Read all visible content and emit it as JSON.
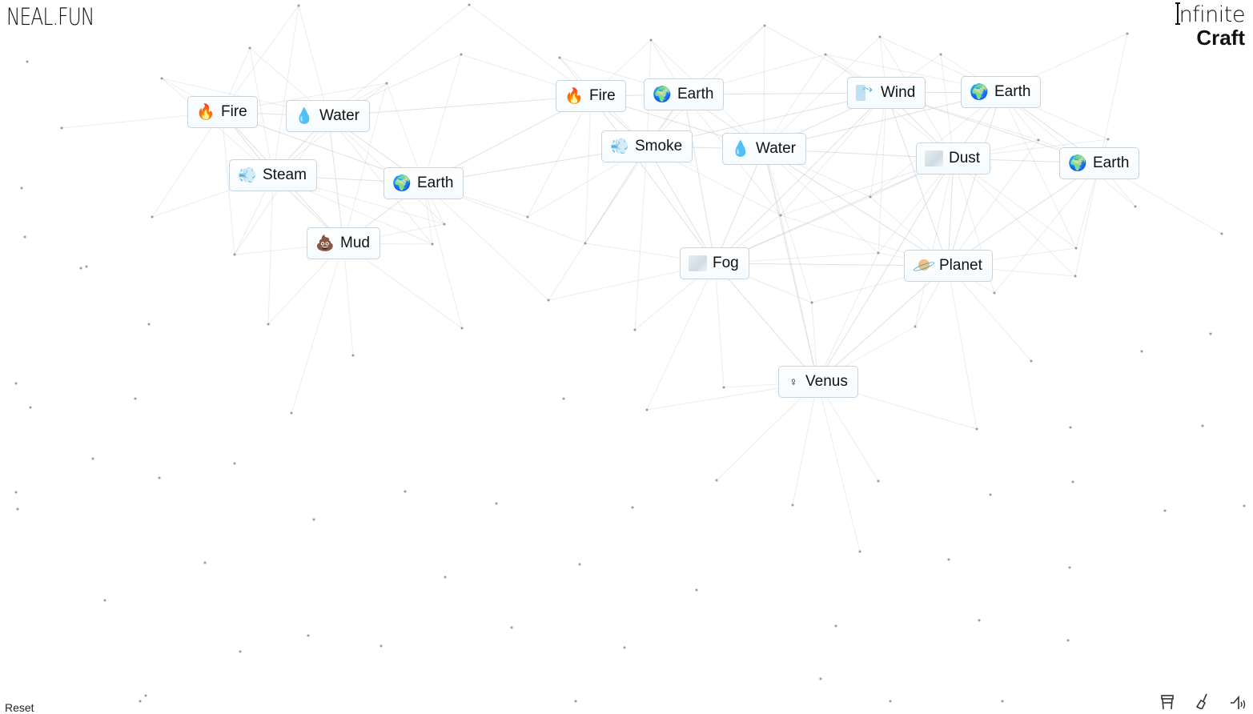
{
  "header": {
    "site_logo": "NEAL.FUN",
    "app_title_line1": "nfinite",
    "app_title_line2": "Craft"
  },
  "footer": {
    "reset_label": "Reset",
    "icons": [
      "coffee-cup-icon",
      "broom-clear-icon",
      "sound-icon"
    ]
  },
  "items": [
    {
      "id": "fire-1",
      "label": "Fire",
      "icon": "🔥",
      "icon_name": "fire-icon"
    },
    {
      "id": "water-1",
      "label": "Water",
      "icon": "💧",
      "icon_name": "water-drop-icon"
    },
    {
      "id": "steam",
      "label": "Steam",
      "icon": "💨",
      "icon_name": "steam-icon"
    },
    {
      "id": "earth-1",
      "label": "Earth",
      "icon": "🌍",
      "icon_name": "earth-globe-icon"
    },
    {
      "id": "mud",
      "label": "Mud",
      "icon": "💩",
      "icon_name": "mud-icon"
    },
    {
      "id": "fire-2",
      "label": "Fire",
      "icon": "🔥",
      "icon_name": "fire-icon"
    },
    {
      "id": "earth-2",
      "label": "Earth",
      "icon": "🌍",
      "icon_name": "earth-globe-icon"
    },
    {
      "id": "smoke",
      "label": "Smoke",
      "icon": "💨",
      "icon_name": "smoke-icon"
    },
    {
      "id": "water-2",
      "label": "Water",
      "icon": "💧",
      "icon_name": "water-drop-icon"
    },
    {
      "id": "wind",
      "label": "Wind",
      "icon": "",
      "icon_name": "wind-icon"
    },
    {
      "id": "earth-3",
      "label": "Earth",
      "icon": "🌍",
      "icon_name": "earth-globe-icon"
    },
    {
      "id": "dust",
      "label": "Dust",
      "icon": "",
      "icon_name": "dust-cloud-icon"
    },
    {
      "id": "earth-4",
      "label": "Earth",
      "icon": "🌍",
      "icon_name": "earth-globe-icon"
    },
    {
      "id": "fog",
      "label": "Fog",
      "icon": "",
      "icon_name": "fog-cloud-icon"
    },
    {
      "id": "planet",
      "label": "Planet",
      "icon": "",
      "icon_name": "planet-icon"
    },
    {
      "id": "venus",
      "label": "Venus",
      "icon": "♀",
      "icon_name": "venus-symbol-icon"
    }
  ]
}
